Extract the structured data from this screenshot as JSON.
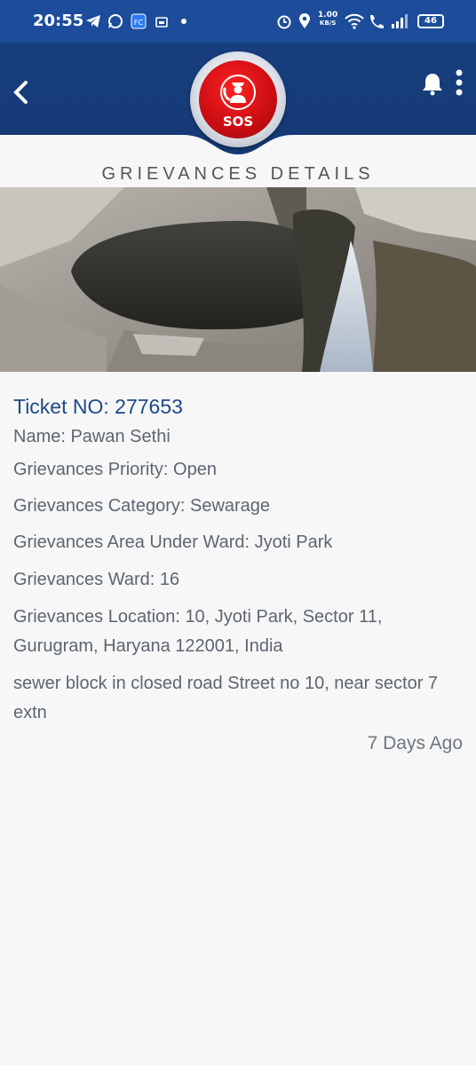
{
  "status_bar": {
    "time": "20:55",
    "speed_value": "1.00",
    "speed_unit": "KB/S",
    "battery": "46"
  },
  "header": {
    "sos_label": "SOS",
    "icons": [
      "back-arrow-icon",
      "bell-icon",
      "more-vert-icon"
    ]
  },
  "page": {
    "title": "GRIEVANCES DETAILS"
  },
  "grievance": {
    "ticket": "Ticket NO: 277653",
    "name": "Name: Pawan Sethi",
    "priority": "Grievances Priority: Open",
    "category": "Grievances Category: Sewarage",
    "area": "Grievances Area Under Ward: Jyoti Park",
    "ward": "Grievances Ward: 16",
    "location": "Grievances Location: 10, Jyoti Park, Sector 11, Gurugram, Haryana 122001, India",
    "description": "sewer block in closed road Street no 10, near sector 7 extn",
    "time_ago": "7 Days Ago"
  },
  "colors": {
    "status_bar": "#1d4d9a",
    "app_bar": "#183e7e",
    "sos_red": "#c90d12",
    "ticket_text": "#1e4a86"
  }
}
